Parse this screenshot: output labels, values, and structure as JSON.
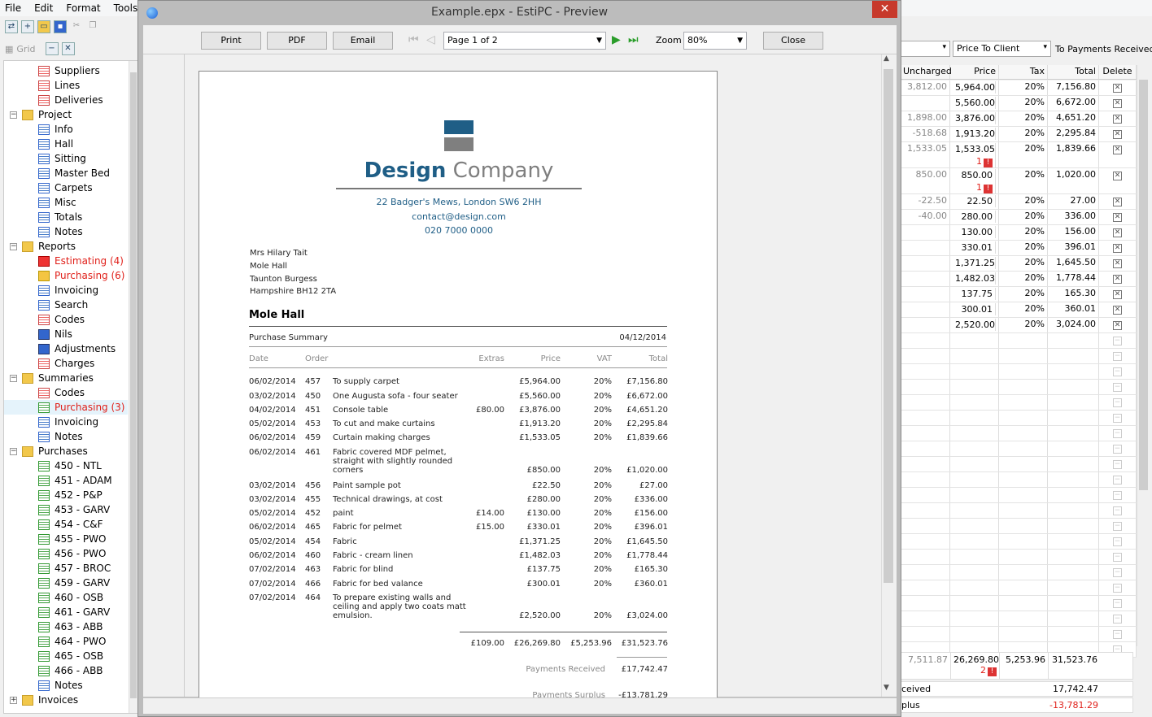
{
  "menu": [
    "File",
    "Edit",
    "Format",
    "Tools"
  ],
  "gridbar": {
    "grid_label": "Grid"
  },
  "tree": [
    {
      "label": "Suppliers",
      "icon": "table-red-icon",
      "level": 2
    },
    {
      "label": "Lines",
      "icon": "table-red-icon",
      "level": 2
    },
    {
      "label": "Deliveries",
      "icon": "table-red-icon",
      "level": 2
    },
    {
      "label": "Project",
      "icon": "folder-icon",
      "level": 1,
      "expander": "−"
    },
    {
      "label": "Info",
      "icon": "info-icon",
      "level": 2
    },
    {
      "label": "Hall",
      "icon": "table-blue-icon",
      "level": 2
    },
    {
      "label": "Sitting",
      "icon": "table-blue-icon",
      "level": 2
    },
    {
      "label": "Master Bed",
      "icon": "table-blue-icon",
      "level": 2
    },
    {
      "label": "Carpets",
      "icon": "table-blue-icon",
      "level": 2
    },
    {
      "label": "Misc",
      "icon": "table-blue-icon",
      "level": 2
    },
    {
      "label": "Totals",
      "icon": "table-blue-icon",
      "level": 2
    },
    {
      "label": "Notes",
      "icon": "notes-icon",
      "level": 2
    },
    {
      "label": "Reports",
      "icon": "folder-icon",
      "level": 1,
      "expander": "−"
    },
    {
      "label": "Estimating (4)",
      "icon": "warning-red-icon",
      "level": 2,
      "alert": true
    },
    {
      "label": "Purchasing (6)",
      "icon": "warning-yellow-icon",
      "level": 2,
      "alert": true
    },
    {
      "label": "Invoicing",
      "icon": "invoice-icon",
      "level": 2
    },
    {
      "label": "Search",
      "icon": "search-icon",
      "level": 2
    },
    {
      "label": "Codes",
      "icon": "table-red-icon",
      "level": 2
    },
    {
      "label": "Nils",
      "icon": "minus-icon",
      "level": 2
    },
    {
      "label": "Adjustments",
      "icon": "adjust-icon",
      "level": 2
    },
    {
      "label": "Charges",
      "icon": "table-red-icon",
      "level": 2
    },
    {
      "label": "Summaries",
      "icon": "folder-icon",
      "level": 1,
      "expander": "−"
    },
    {
      "label": "Codes",
      "icon": "table-red-icon",
      "level": 2
    },
    {
      "label": "Purchasing (3)",
      "icon": "table-green-icon",
      "level": 2,
      "alert": true,
      "selected": true
    },
    {
      "label": "Invoicing",
      "icon": "invoice-icon",
      "level": 2
    },
    {
      "label": "Notes",
      "icon": "notes-icon",
      "level": 2
    },
    {
      "label": "Purchases",
      "icon": "folder-icon",
      "level": 1,
      "expander": "−"
    },
    {
      "label": "450 - NTL",
      "icon": "table-green-icon",
      "level": 2
    },
    {
      "label": "451 - ADAM",
      "icon": "table-green-icon",
      "level": 2
    },
    {
      "label": "452 - P&P",
      "icon": "table-green-icon",
      "level": 2
    },
    {
      "label": "453 - GARV",
      "icon": "table-green-icon",
      "level": 2
    },
    {
      "label": "454 - C&F",
      "icon": "table-green-icon",
      "level": 2
    },
    {
      "label": "455 - PWO",
      "icon": "table-green-icon",
      "level": 2
    },
    {
      "label": "456 - PWO",
      "icon": "table-green-icon",
      "level": 2
    },
    {
      "label": "457 - BROC",
      "icon": "table-green-icon",
      "level": 2
    },
    {
      "label": "459 - GARV",
      "icon": "table-green-icon",
      "level": 2
    },
    {
      "label": "460 - OSB",
      "icon": "table-green-icon",
      "level": 2
    },
    {
      "label": "461 - GARV",
      "icon": "table-green-icon",
      "level": 2
    },
    {
      "label": "463 - ABB",
      "icon": "table-green-icon",
      "level": 2
    },
    {
      "label": "464 - PWO",
      "icon": "table-green-icon",
      "level": 2
    },
    {
      "label": "465 - OSB",
      "icon": "table-green-icon",
      "level": 2
    },
    {
      "label": "466 - ABB",
      "icon": "table-green-icon",
      "level": 2
    },
    {
      "label": "Notes",
      "icon": "notes-icon",
      "level": 2
    },
    {
      "label": "Invoices",
      "icon": "folder-icon",
      "level": 1,
      "expander": "+"
    }
  ],
  "right": {
    "price_mode": "Price To Client",
    "to_payments": "To Payments Received",
    "columns": [
      "Uncharged",
      "Price",
      "Tax",
      "Total",
      "Delete"
    ],
    "rows": [
      {
        "uncharged": "3,812.00",
        "price": "5,964.00",
        "tax": "20%",
        "total": "7,156.80"
      },
      {
        "uncharged": "",
        "price": "5,560.00",
        "tax": "20%",
        "total": "6,672.00"
      },
      {
        "uncharged": "1,898.00",
        "price": "3,876.00",
        "tax": "20%",
        "total": "4,651.20"
      },
      {
        "uncharged": "-518.68",
        "price": "1,913.20",
        "tax": "20%",
        "total": "2,295.84"
      },
      {
        "uncharged": "1,533.05",
        "price": "1,533.05",
        "tax": "20%",
        "total": "1,839.66",
        "flag": "1"
      },
      {
        "uncharged": "850.00",
        "price": "850.00",
        "tax": "20%",
        "total": "1,020.00",
        "flag": "1"
      },
      {
        "uncharged": "-22.50",
        "price": "22.50",
        "tax": "20%",
        "total": "27.00"
      },
      {
        "uncharged": "-40.00",
        "price": "280.00",
        "tax": "20%",
        "total": "336.00"
      },
      {
        "uncharged": "",
        "price": "130.00",
        "tax": "20%",
        "total": "156.00"
      },
      {
        "uncharged": "",
        "price": "330.01",
        "tax": "20%",
        "total": "396.01"
      },
      {
        "uncharged": "",
        "price": "1,371.25",
        "tax": "20%",
        "total": "1,645.50"
      },
      {
        "uncharged": "",
        "price": "1,482.03",
        "tax": "20%",
        "total": "1,778.44"
      },
      {
        "uncharged": "",
        "price": "137.75",
        "tax": "20%",
        "total": "165.30"
      },
      {
        "uncharged": "",
        "price": "300.01",
        "tax": "20%",
        "total": "360.01"
      },
      {
        "uncharged": "",
        "price": "2,520.00",
        "tax": "20%",
        "total": "3,024.00"
      }
    ],
    "totals": {
      "uncharged": "7,511.87",
      "price": "26,269.80",
      "flag": "2",
      "tax": "5,253.96",
      "total": "31,523.76"
    },
    "received_label": "ceived",
    "received_value": "17,742.47",
    "surplus_label": "plus",
    "surplus_value": "-13,781.29"
  },
  "preview": {
    "title": "Example.epx - EstiPC - Preview",
    "close_x": "✕",
    "print": "Print",
    "pdf": "PDF",
    "email": "Email",
    "page": "Page 1 of 2",
    "zoom_label": "Zoom",
    "zoom": "80%",
    "close": "Close"
  },
  "doc": {
    "brand_bold": "Design",
    "brand_rest": "Company",
    "address": "22 Badger's Mews, London SW6 2HH",
    "email": "contact@design.com",
    "phone": "020 7000 0000",
    "customer": [
      "Mrs Hilary Tait",
      "Mole Hall",
      "Taunton Burgess",
      "Hampshire BH12 2TA"
    ],
    "project": "Mole Hall",
    "subtitle": "Purchase Summary",
    "date": "04/12/2014",
    "headers": {
      "date": "Date",
      "order": "Order",
      "extras": "Extras",
      "price": "Price",
      "vat": "VAT",
      "total": "Total"
    },
    "rows": [
      {
        "date": "06/02/2014",
        "order": "457",
        "desc": [
          "To supply carpet"
        ],
        "extras": "",
        "price": "£5,964.00",
        "vat": "20%",
        "total": "£7,156.80"
      },
      {
        "date": "03/02/2014",
        "order": "450",
        "desc": [
          "One Augusta  sofa - four seater"
        ],
        "extras": "",
        "price": "£5,560.00",
        "vat": "20%",
        "total": "£6,672.00"
      },
      {
        "date": "04/02/2014",
        "order": "451",
        "desc": [
          "Console table"
        ],
        "extras": "£80.00",
        "price": "£3,876.00",
        "vat": "20%",
        "total": "£4,651.20"
      },
      {
        "date": "05/02/2014",
        "order": "453",
        "desc": [
          "To cut and make curtains"
        ],
        "extras": "",
        "price": "£1,913.20",
        "vat": "20%",
        "total": "£2,295.84"
      },
      {
        "date": "06/02/2014",
        "order": "459",
        "desc": [
          "Curtain making charges"
        ],
        "extras": "",
        "price": "£1,533.05",
        "vat": "20%",
        "total": "£1,839.66"
      },
      {
        "date": "06/02/2014",
        "order": "461",
        "desc": [
          "Fabric covered MDF pelmet,",
          "straight with slightly rounded",
          "corners"
        ],
        "extras": "",
        "price": "£850.00",
        "vat": "20%",
        "total": "£1,020.00"
      },
      {
        "date": "03/02/2014",
        "order": "456",
        "desc": [
          "Paint sample pot"
        ],
        "extras": "",
        "price": "£22.50",
        "vat": "20%",
        "total": "£27.00"
      },
      {
        "date": "03/02/2014",
        "order": "455",
        "desc": [
          "Technical drawings, at cost"
        ],
        "extras": "",
        "price": "£280.00",
        "vat": "20%",
        "total": "£336.00"
      },
      {
        "date": "05/02/2014",
        "order": "452",
        "desc": [
          "paint"
        ],
        "extras": "£14.00",
        "price": "£130.00",
        "vat": "20%",
        "total": "£156.00"
      },
      {
        "date": "06/02/2014",
        "order": "465",
        "desc": [
          "Fabric for pelmet"
        ],
        "extras": "£15.00",
        "price": "£330.01",
        "vat": "20%",
        "total": "£396.01"
      },
      {
        "date": "05/02/2014",
        "order": "454",
        "desc": [
          "Fabric"
        ],
        "extras": "",
        "price": "£1,371.25",
        "vat": "20%",
        "total": "£1,645.50"
      },
      {
        "date": "06/02/2014",
        "order": "460",
        "desc": [
          "Fabric - cream linen"
        ],
        "extras": "",
        "price": "£1,482.03",
        "vat": "20%",
        "total": "£1,778.44"
      },
      {
        "date": "07/02/2014",
        "order": "463",
        "desc": [
          "Fabric for blind"
        ],
        "extras": "",
        "price": "£137.75",
        "vat": "20%",
        "total": "£165.30"
      },
      {
        "date": "07/02/2014",
        "order": "466",
        "desc": [
          "Fabric for bed valance"
        ],
        "extras": "",
        "price": "£300.01",
        "vat": "20%",
        "total": "£360.01"
      },
      {
        "date": "07/02/2014",
        "order": "464",
        "desc": [
          "To prepare existing walls and",
          "ceiling and apply two coats matt",
          "emulsion."
        ],
        "extras": "",
        "price": "£2,520.00",
        "vat": "20%",
        "total": "£3,024.00"
      }
    ],
    "totals": {
      "extras": "£109.00",
      "price": "£26,269.80",
      "vat": "£5,253.96",
      "total": "£31,523.76"
    },
    "payments_received_label": "Payments Received",
    "payments_received": "£17,742.47",
    "payments_surplus_label": "Payments Surplus",
    "payments_surplus": "-£13,781.29"
  }
}
